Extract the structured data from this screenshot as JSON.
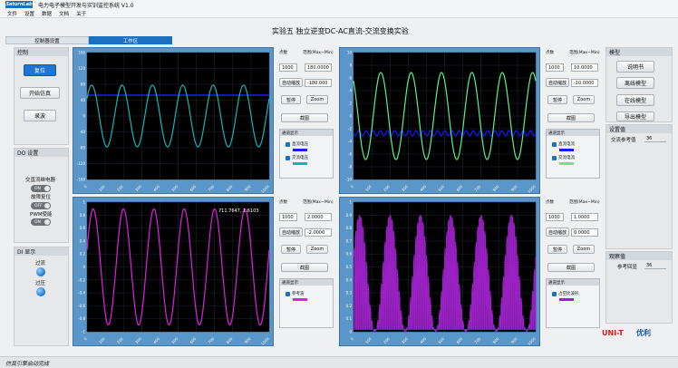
{
  "app": {
    "logo": "SaturnLab",
    "title": "电力电子模型开发与实训监控系统 V1.0"
  },
  "menu": [
    "文件",
    "设置",
    "数据",
    "文档",
    "关于"
  ],
  "tabs": [
    "控制器设置",
    "工作区"
  ],
  "experiment_title": "实验五 独立逆变DC-AC直流-交流变换实验",
  "control": {
    "header": "控制",
    "reset": "复位",
    "start": "开始仿真",
    "record": "录波"
  },
  "do_settings": {
    "header": "DO 设置",
    "items": [
      {
        "label": "交直流继电器",
        "state": "ON"
      },
      {
        "label": "故障复位",
        "state": "OFF"
      },
      {
        "label": "PWM使能",
        "state": "ON"
      }
    ]
  },
  "di_display": {
    "header": "DI 显示",
    "items": [
      "过流",
      "过压"
    ]
  },
  "scopes": [
    {
      "points_label": "点数",
      "range_label": "范围(Max~Min)",
      "points": "1000",
      "max": "180.0000",
      "min": "-180.000",
      "auto_scale": "自动缩放",
      "pause": "暂停",
      "zoom": "Zoom",
      "screenshot": "截图",
      "channel_header": "通道显示",
      "channels": [
        {
          "name": "直流电压",
          "color": "#1a1aff"
        },
        {
          "name": "交流电压",
          "color": "#19b4b4"
        }
      ],
      "y_ticks": [
        "160",
        "120",
        "80",
        "40",
        "0",
        "-40",
        "-80",
        "-120",
        "-160"
      ],
      "readout": ""
    },
    {
      "points_label": "点数",
      "range_label": "范围(Max~Min)",
      "points": "1000",
      "max": "10.0000",
      "min": "-10.0000",
      "auto_scale": "自动缩放",
      "pause": "暂停",
      "zoom": "Zoom",
      "screenshot": "截图",
      "channel_header": "通道显示",
      "channels": [
        {
          "name": "直流电流",
          "color": "#1a1aff"
        },
        {
          "name": "交流电流",
          "color": "#5cf08c"
        }
      ],
      "y_ticks": [
        "10",
        "8",
        "6",
        "4",
        "2",
        "0",
        "-2",
        "-4",
        "-6",
        "-8",
        "-10"
      ],
      "readout": ""
    },
    {
      "points_label": "点数",
      "range_label": "范围(Max~Min)",
      "points": "1000",
      "max": "2.0000",
      "min": "-2.0000",
      "auto_scale": "自动缩放",
      "pause": "暂停",
      "zoom": "Zoom",
      "screenshot": "截图",
      "channel_header": "通道显示",
      "channels": [
        {
          "name": "参考波",
          "color": "#e020e0"
        }
      ],
      "y_ticks": [
        "1",
        "0.8",
        "0.6",
        "0.4",
        "0.2",
        "0",
        "-0.2",
        "-0.4",
        "-0.6",
        "-0.8",
        "-1"
      ],
      "readout": "711.7647, 1.6103"
    },
    {
      "points_label": "点数",
      "range_label": "范围(Max~Min)",
      "points": "1000",
      "max": "1.0000",
      "min": "0.0000",
      "auto_scale": "自动缩放",
      "pause": "暂停",
      "zoom": "Zoom",
      "screenshot": "截图",
      "channel_header": "通道显示",
      "channels": [
        {
          "name": "占空比波形",
          "color": "#9a22c4"
        }
      ],
      "y_ticks": [
        "1",
        "0.9",
        "0.8",
        "0.7",
        "0.6",
        "0.5",
        "0.4",
        "0.3",
        "0.2",
        "0.1",
        "0"
      ],
      "readout": ""
    }
  ],
  "x_ticks": [
    "0",
    "100",
    "200",
    "300",
    "400",
    "500",
    "600",
    "700",
    "800",
    "900",
    "1000"
  ],
  "model": {
    "header": "模型",
    "buttons": [
      "说明书",
      "离线模型",
      "在线模型",
      "导出模型"
    ]
  },
  "setpoint": {
    "header": "设置值",
    "label": "交流参考值",
    "value": "36"
  },
  "observed": {
    "header": "观察值",
    "label": "参考回显",
    "value": "36"
  },
  "brand": {
    "uni": "UNI-T",
    "second": "优利"
  },
  "status": "仿真引擎启动完成"
}
